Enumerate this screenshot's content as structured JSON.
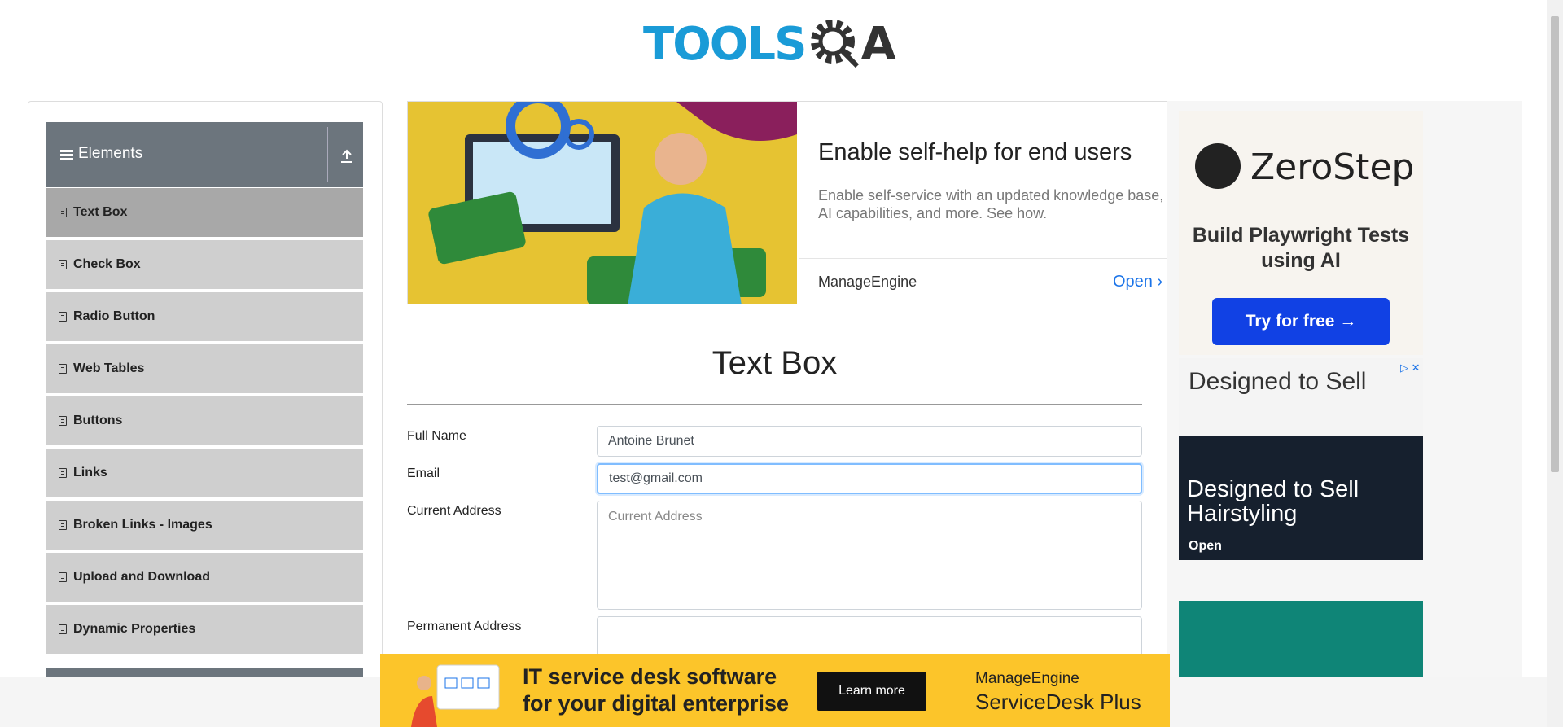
{
  "header": {
    "logo_left": "TOOLS",
    "logo_right": "A"
  },
  "sidebar": {
    "group_title": "Elements",
    "items": [
      {
        "label": "Text Box",
        "active": true
      },
      {
        "label": "Check Box"
      },
      {
        "label": "Radio Button"
      },
      {
        "label": "Web Tables"
      },
      {
        "label": "Buttons"
      },
      {
        "label": "Links"
      },
      {
        "label": "Broken Links - Images"
      },
      {
        "label": "Upload and Download"
      },
      {
        "label": "Dynamic Properties"
      }
    ]
  },
  "top_ad": {
    "headline": "Enable self-help for end users",
    "subtext": "Enable self-service with an updated knowledge base, AI capabilities, and more. See how.",
    "brand": "ManageEngine",
    "cta": "Open"
  },
  "form": {
    "title": "Text Box",
    "full_name_label": "Full Name",
    "full_name_value": "Antoine Brunet",
    "email_label": "Email",
    "email_value": "test@gmail.com",
    "current_address_label": "Current Address",
    "current_address_placeholder": "Current Address",
    "permanent_address_label": "Permanent Address"
  },
  "right_ads": {
    "zerostep_name": "ZeroStep",
    "zerostep_tagline": "Build Playwright Tests using AI",
    "zerostep_cta": "Try for free →",
    "squarespace_title": "Designed to Sell",
    "squarespace_big": "Designed to Sell Hairstyling",
    "squarespace_open": "Open"
  },
  "bottom_ad": {
    "headline": "IT service desk software for your digital enterprise",
    "cta": "Learn more",
    "brand": "ManageEngine",
    "product": "ServiceDesk Plus"
  },
  "colors": {
    "accent": "#1a9bd7",
    "sidebar_header": "#6c757d",
    "ad_button": "#1141e4",
    "bottom_ad_bg": "#fcc52a"
  }
}
